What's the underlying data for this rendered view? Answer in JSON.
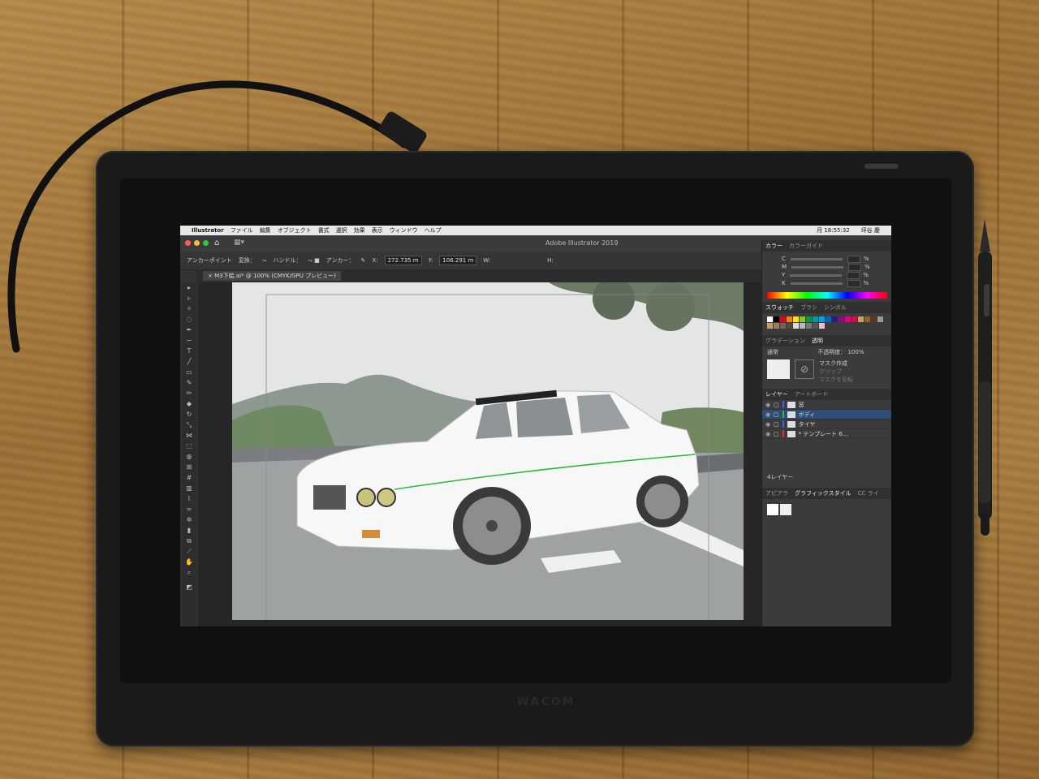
{
  "menubar": {
    "app": "Illustrator",
    "items": [
      "ファイル",
      "編集",
      "オブジェクト",
      "書式",
      "選択",
      "効果",
      "表示",
      "ウィンドウ",
      "ヘルプ"
    ],
    "clock": "月 18:55:32",
    "user": "坪谷 慶"
  },
  "window": {
    "title": "Adobe Illustrator 2019"
  },
  "control_bar": {
    "anchor_point": "アンカーポイント",
    "convert": "変換：",
    "handle": "ハンドル：",
    "anchor": "アンカー：",
    "x_label": "X:",
    "x_value": "272.735 m",
    "y_label": "Y:",
    "y_value": "106.291 m",
    "w_label": "W:",
    "h_label": "H:"
  },
  "document_tab": {
    "label": "M3下絵.ai* @ 100% (CMYK/GPU プレビュー)"
  },
  "color_panel": {
    "tabs": [
      "カラー",
      "カラーガイド"
    ],
    "channels": [
      {
        "name": "C",
        "unit": "%"
      },
      {
        "name": "M",
        "unit": "%"
      },
      {
        "name": "Y",
        "unit": "%"
      },
      {
        "name": "K",
        "unit": "%"
      }
    ]
  },
  "swatches_panel": {
    "tabs": [
      "スウォッチ",
      "ブラシ",
      "シンボル"
    ]
  },
  "transparency_panel": {
    "tabs": [
      "グラデーション",
      "透明"
    ],
    "mode": "通常",
    "opacity_label": "不透明度：",
    "opacity_value": "100%",
    "make_mask": "マスク作成",
    "clip": "クリップ",
    "invert_mask": "マスクを反転"
  },
  "layers_panel": {
    "tabs": [
      "レイヤー",
      "アートボード"
    ],
    "layers": [
      {
        "name": "窓",
        "color": "#3b5bff"
      },
      {
        "name": "ボディ",
        "color": "#2fb84a"
      },
      {
        "name": "タイヤ",
        "color": "#3b5bff"
      },
      {
        "name": "* テンプレート 6...",
        "color": "#e03030"
      }
    ],
    "count": "4レイヤー"
  },
  "appearance_panel": {
    "tabs": [
      "アピアラ",
      "グラフィックスタイル",
      "CC ライ"
    ]
  },
  "device": {
    "brand": "WACOM"
  }
}
